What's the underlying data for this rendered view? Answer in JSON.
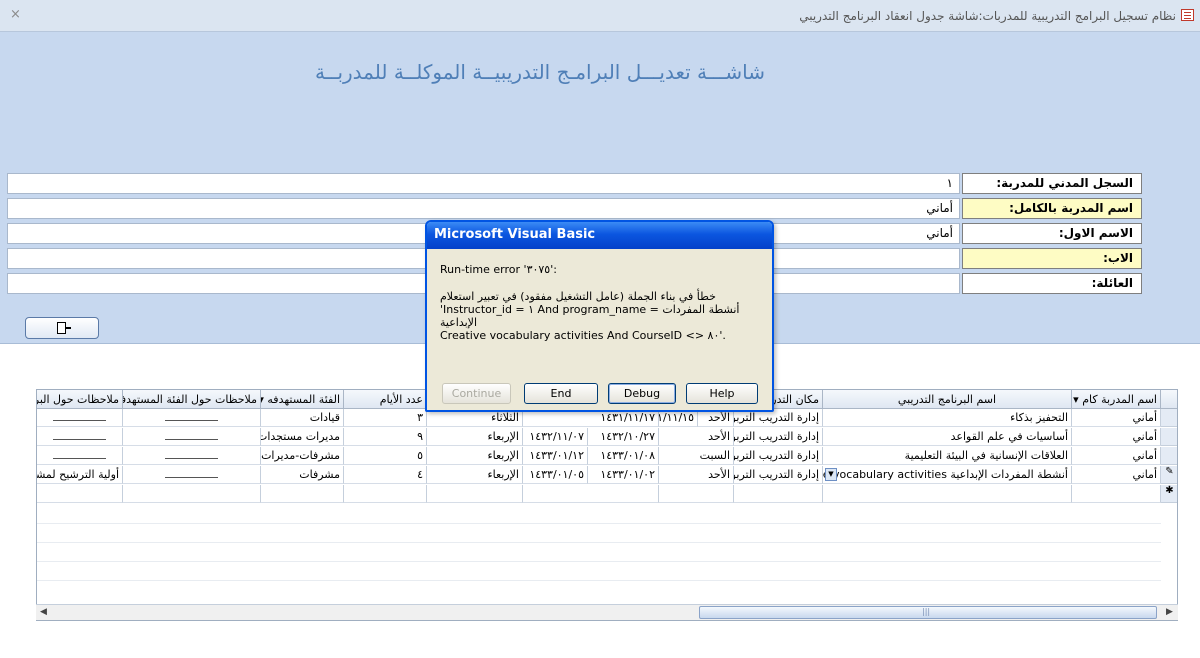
{
  "window": {
    "title": "نظام تسجيل البرامج التدريبية للمدربات:شاشة جدول انعقاد البرنامج التدريبي",
    "close_glyph": "×",
    "app_icon": "form-icon"
  },
  "form": {
    "heading": "شاشـــة تعديـــل البرامـج التدريبيــة الموكلــة للمدربــة",
    "fields": [
      {
        "label": "السجل المدني للمدربة:",
        "value": "١"
      },
      {
        "label": "اسم المدربة بالكامل:",
        "value": "أماني"
      },
      {
        "label": "الاسم الاول:",
        "value": "أماني"
      },
      {
        "label": "الاب:",
        "value": ""
      },
      {
        "label": "العائلة:",
        "value": ""
      }
    ],
    "exit_button_icon": "exit-door-icon"
  },
  "grid": {
    "columns": [
      "اسم المدربة كام ▾",
      "اسم البرنامج التدريبي",
      "مكان التدريب",
      "",
      "",
      "",
      "عدد الأيام",
      "الفئة المستهدفه ▾",
      "ملاحظات حول الفئة المستهدفة ▾",
      "ملاحظات حول البرنامج"
    ],
    "rows": [
      {
        "selector": "",
        "trainer": "أماني",
        "program": "التحفيز بذكاء",
        "place": "إدارة التدريب التربوي",
        "start_day": "الأحد",
        "start_date": "١٤٣١/١١/١٥",
        "end_date": "١٤٣١/١١/١٧",
        "end_day": "الثلاثاء",
        "days": "٣",
        "audience": "قيادات",
        "audience_notes": "",
        "notes": ""
      },
      {
        "selector": "",
        "trainer": "أماني",
        "program": "أساسيات في علم القواعد",
        "place": "إدارة التدريب التربوي",
        "start_day": "الأحد",
        "start_date": "١٤٣٢/١٠/٢٧",
        "end_date": "١٤٣٢/١١/٠٧",
        "end_day": "الإربعاء",
        "days": "٩",
        "audience": "مديرات مستجدات",
        "audience_notes": "",
        "notes": ""
      },
      {
        "selector": "",
        "trainer": "أماني",
        "program": "العلاقات الإنسانية في البيئة التعليمية",
        "place": "إدارة التدريب التربوي",
        "start_day": "السبت",
        "start_date": "١٤٣٣/٠١/٠٨",
        "end_date": "١٤٣٣/٠١/١٢",
        "end_day": "الإربعاء",
        "days": "٥",
        "audience": "مشرفات-مديرات-",
        "audience_notes": "",
        "notes": ""
      },
      {
        "selector": "✎",
        "trainer": "أماني",
        "program": "أنشطة المفردات الإبداعية Creative vocabulary activities",
        "place": "إدارة التدريب التربوي",
        "start_day": "الأحد",
        "start_date": "١٤٣٣/٠١/٠٢",
        "end_date": "١٤٣٣/٠١/٠٥",
        "end_day": "الإربعاء",
        "days": "٤",
        "audience": "مشرفات",
        "audience_notes": "",
        "notes": "أولية الترشيح لمشرفات"
      },
      {
        "selector": "✱",
        "trainer": "",
        "program": "",
        "place": "",
        "start_day": "",
        "start_date": "",
        "end_date": "",
        "end_day": "",
        "days": "",
        "audience": "",
        "audience_notes": "",
        "notes": ""
      }
    ],
    "scrollbar": {
      "left_arrow": "◀",
      "right_arrow": "▶",
      "grip": "|||"
    }
  },
  "dialog": {
    "title": "Microsoft Visual Basic",
    "error_line": "Run-time error '٣٠٧٥':",
    "message_line1": "خطأ في بناء الجملة (عامل التشغيل مفقود) في تعبير استعلام",
    "message_line2": "'Instructor_id = ١ And program_name = أنشطة المفردات الإبداعية",
    "message_line3": "Creative vocabulary activities And CourseID <> ٨٠'.",
    "buttons": {
      "continue": "Continue",
      "end": "End",
      "debug": "Debug",
      "help": "Help"
    }
  }
}
